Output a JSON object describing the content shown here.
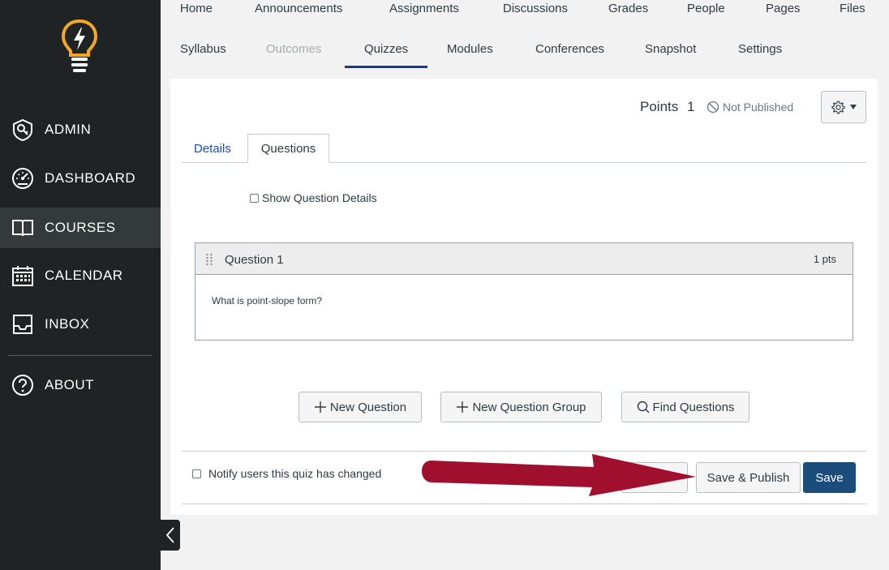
{
  "sidebar": {
    "items": [
      {
        "label": "ADMIN",
        "icon": "admin-shield-icon"
      },
      {
        "label": "DASHBOARD",
        "icon": "dashboard-gauge-icon"
      },
      {
        "label": "COURSES",
        "icon": "courses-book-icon",
        "active": true
      },
      {
        "label": "CALENDAR",
        "icon": "calendar-icon"
      },
      {
        "label": "INBOX",
        "icon": "inbox-icon"
      },
      {
        "label": "ABOUT",
        "icon": "help-circle-icon"
      }
    ]
  },
  "course_nav": {
    "row1": [
      "Home",
      "Announcements",
      "Assignments",
      "Discussions",
      "Grades",
      "People",
      "Pages",
      "Files"
    ],
    "row2": [
      "Syllabus",
      "Outcomes",
      "Quizzes",
      "Modules",
      "Conferences",
      "Snapshot",
      "Settings"
    ],
    "active": "Quizzes",
    "disabled": "Outcomes"
  },
  "header": {
    "points_label": "Points",
    "points_value": "1",
    "status": "Not Published"
  },
  "tabs": {
    "details": "Details",
    "questions": "Questions"
  },
  "show_details_label": "Show Question Details",
  "question": {
    "title": "Question 1",
    "points": "1 pts",
    "text": "What is point-slope form?"
  },
  "buttons": {
    "new_question": "New Question",
    "new_question_group": "New Question Group",
    "find_questions": "Find Questions",
    "save_publish": "Save & Publish",
    "save": "Save"
  },
  "footer": {
    "notify_label": "Notify users this quiz has changed"
  },
  "colors": {
    "sidebar_bg": "#1f2326",
    "accent_blue": "#1a3a8a",
    "save_bg": "#1b4d7c",
    "arrow": "#a0102e",
    "logo": "#f5a623"
  }
}
